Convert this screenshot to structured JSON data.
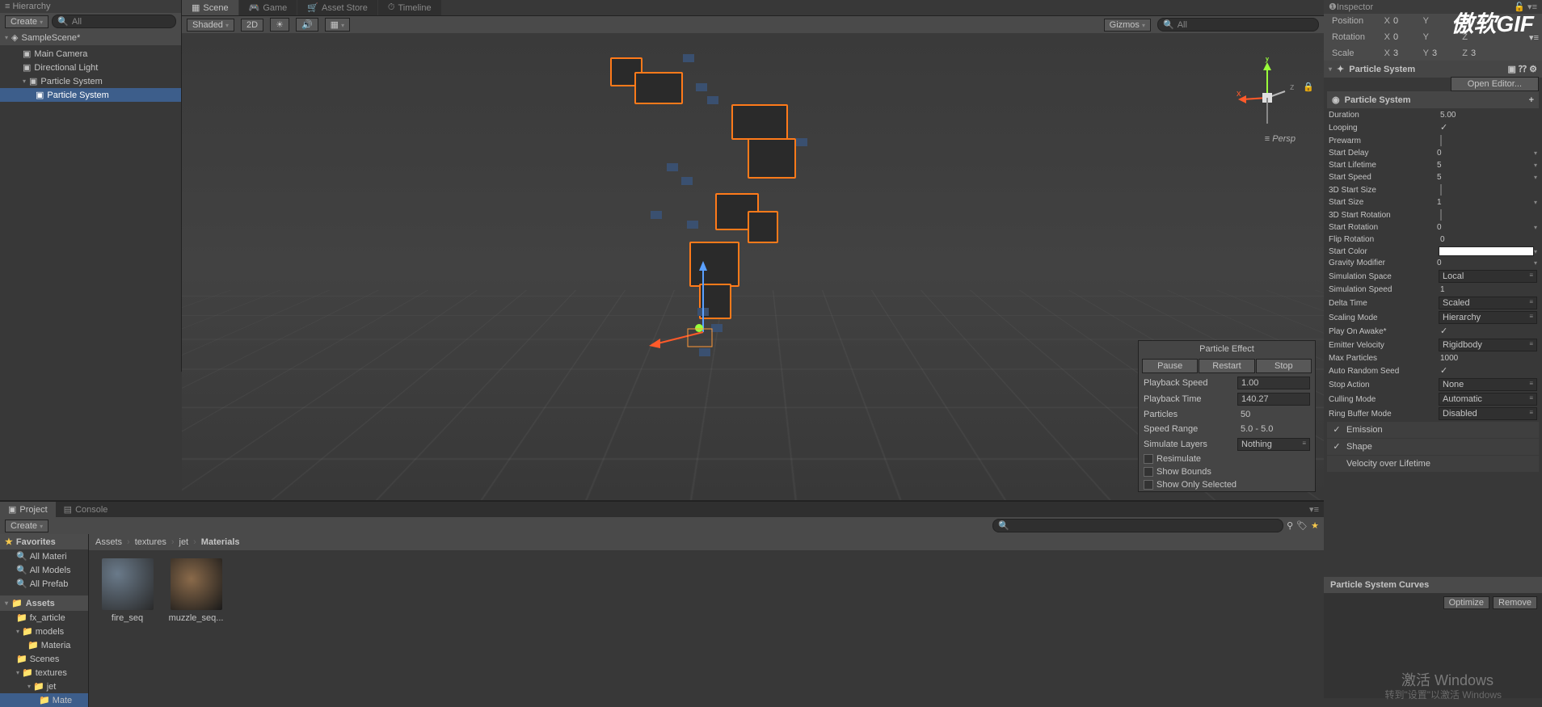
{
  "hierarchy": {
    "create": "Create",
    "search_placeholder": "All",
    "scene": "SampleScene*",
    "items": [
      "Main Camera",
      "Directional Light",
      "Particle System",
      "Particle System"
    ]
  },
  "scene": {
    "tabs": [
      "Scene",
      "Game",
      "Asset Store",
      "Timeline"
    ],
    "shaded": "Shaded",
    "twod": "2D",
    "gizmos": "Gizmos",
    "search_placeholder": "All",
    "persp": "Persp",
    "axes": {
      "x": "x",
      "y": "y",
      "z": "z"
    }
  },
  "particle_effect": {
    "title": "Particle Effect",
    "pause": "Pause",
    "restart": "Restart",
    "stop": "Stop",
    "playback_speed_label": "Playback Speed",
    "playback_speed": "1.00",
    "playback_time_label": "Playback Time",
    "playback_time": "140.27",
    "particles_label": "Particles",
    "particles": "50",
    "speed_range_label": "Speed Range",
    "speed_range": "5.0 - 5.0",
    "simulate_layers_label": "Simulate Layers",
    "simulate_layers": "Nothing",
    "resimulate": "Resimulate",
    "show_bounds": "Show Bounds",
    "show_only_selected": "Show Only Selected"
  },
  "project": {
    "tab_project": "Project",
    "tab_console": "Console",
    "create": "Create",
    "favorites": "Favorites",
    "fav_items": [
      "All Materi",
      "All Models",
      "All Prefab"
    ],
    "assets": "Assets",
    "folders": [
      "fx_article",
      "models",
      "Materia",
      "Scenes",
      "textures",
      "jet",
      "Mate"
    ],
    "breadcrumb": [
      "Assets",
      "textures",
      "jet",
      "Materials"
    ],
    "thumbs": [
      "fire_seq",
      "muzzle_seq..."
    ]
  },
  "inspector": {
    "title": "Inspector",
    "transform": {
      "position_label": "Position",
      "rotation_label": "Rotation",
      "scale_label": "Scale",
      "position": {
        "x": "0",
        "y": "",
        "z": ""
      },
      "rotation": {
        "x": "0",
        "y": "",
        "z": ""
      },
      "scale": {
        "x": "3",
        "y": "3",
        "z": "3"
      }
    },
    "component_title": "Particle System",
    "open_editor": "Open Editor...",
    "module_main": "Particle System",
    "props": {
      "duration_label": "Duration",
      "duration": "5.00",
      "looping_label": "Looping",
      "prewarm_label": "Prewarm",
      "start_delay_label": "Start Delay",
      "start_delay": "0",
      "start_lifetime_label": "Start Lifetime",
      "start_lifetime": "5",
      "start_speed_label": "Start Speed",
      "start_speed": "5",
      "start_size_3d_label": "3D Start Size",
      "start_size_label": "Start Size",
      "start_size": "1",
      "start_rotation_3d_label": "3D Start Rotation",
      "start_rotation_label": "Start Rotation",
      "start_rotation": "0",
      "flip_rotation_label": "Flip Rotation",
      "flip_rotation": "0",
      "start_color_label": "Start Color",
      "gravity_modifier_label": "Gravity Modifier",
      "gravity_modifier": "0",
      "simulation_space_label": "Simulation Space",
      "simulation_space": "Local",
      "simulation_speed_label": "Simulation Speed",
      "simulation_speed": "1",
      "delta_time_label": "Delta Time",
      "delta_time": "Scaled",
      "scaling_mode_label": "Scaling Mode",
      "scaling_mode": "Hierarchy",
      "play_on_awake_label": "Play On Awake*",
      "emitter_velocity_label": "Emitter Velocity",
      "emitter_velocity": "Rigidbody",
      "max_particles_label": "Max Particles",
      "max_particles": "1000",
      "auto_random_seed_label": "Auto Random Seed",
      "stop_action_label": "Stop Action",
      "stop_action": "None",
      "culling_mode_label": "Culling Mode",
      "culling_mode": "Automatic",
      "ring_buffer_label": "Ring Buffer Mode",
      "ring_buffer": "Disabled"
    },
    "modules": [
      "Emission",
      "Shape",
      "Velocity over Lifetime"
    ],
    "curves_title": "Particle System Curves",
    "optimize": "Optimize",
    "remove": "Remove"
  },
  "watermarks": {
    "gif": "傲软GIF",
    "win1": "激活 Windows",
    "win2": "转到\"设置\"以激活 Windows"
  }
}
